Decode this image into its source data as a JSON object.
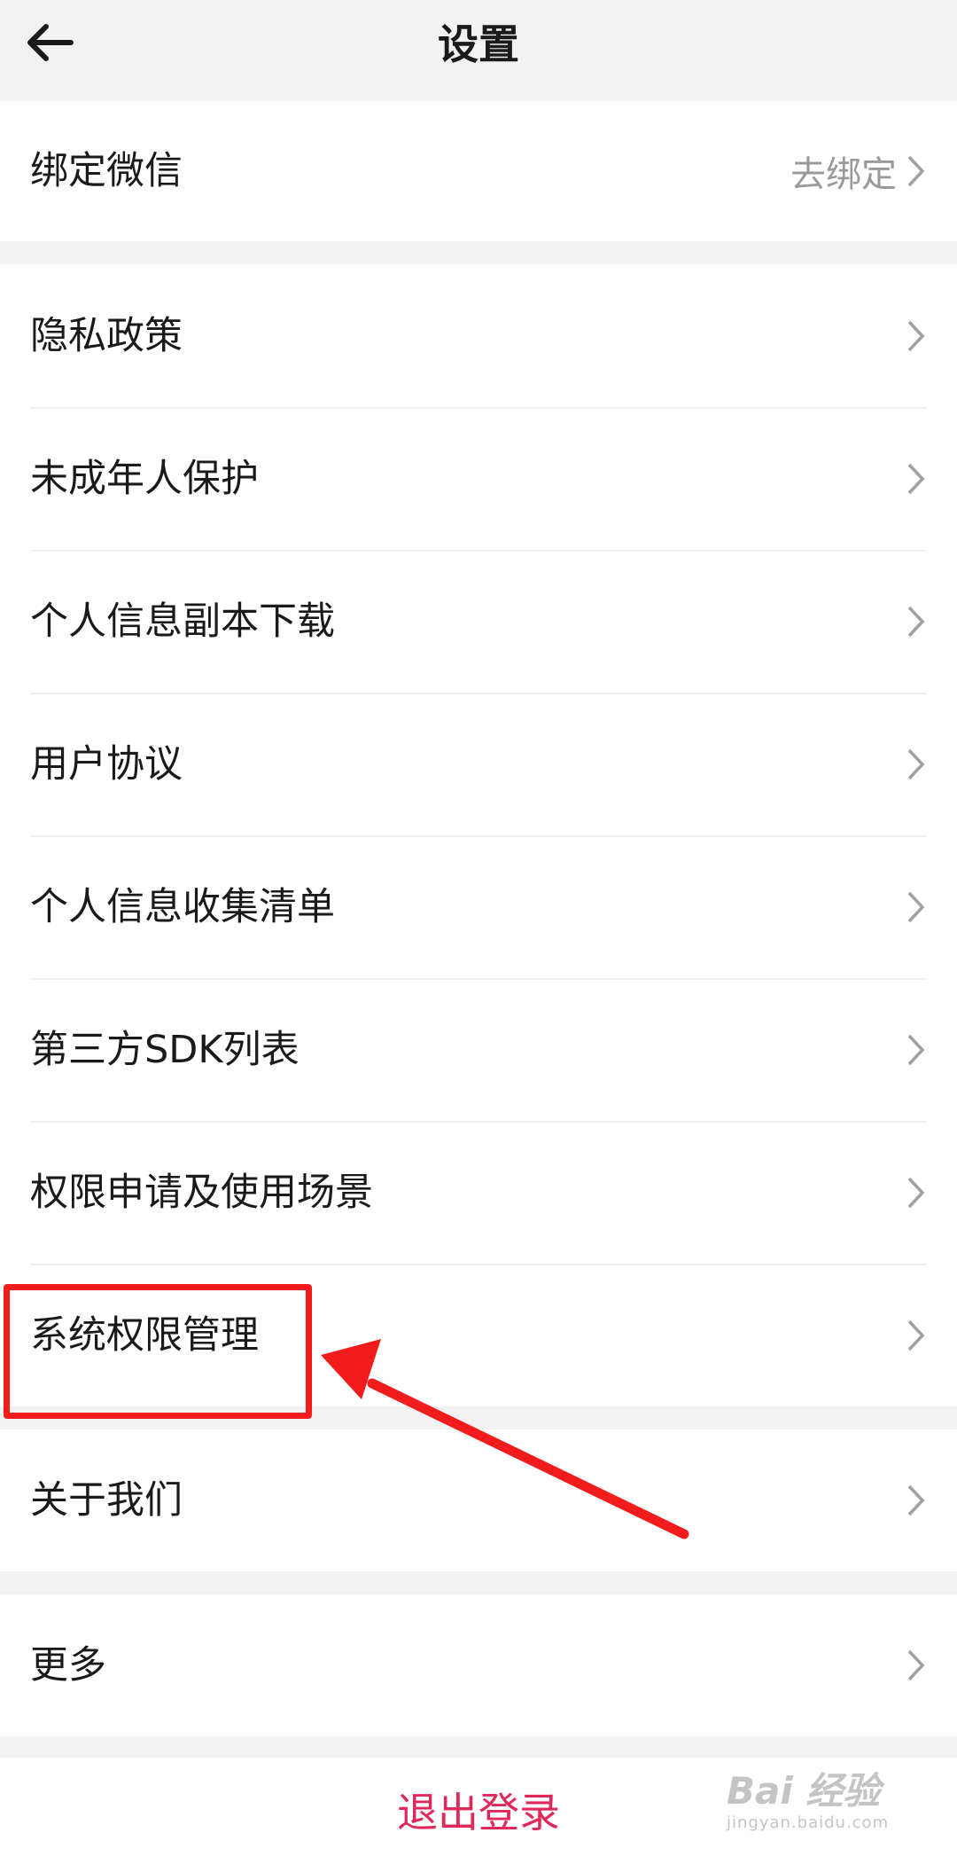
{
  "header": {
    "title": "设置",
    "back_icon": "arrow-left-icon"
  },
  "wechat_group": {
    "label": "绑定微信",
    "value": "去绑定"
  },
  "main_group": {
    "items": [
      {
        "label": "隐私政策"
      },
      {
        "label": "未成年人保护"
      },
      {
        "label": "个人信息副本下载"
      },
      {
        "label": "用户协议"
      },
      {
        "label": "个人信息收集清单"
      },
      {
        "label": "第三方SDK列表"
      },
      {
        "label": "权限申请及使用场景"
      },
      {
        "label": "系统权限管理"
      }
    ]
  },
  "about_group": {
    "label": "关于我们"
  },
  "more_group": {
    "label": "更多"
  },
  "logout": {
    "label": "退出登录"
  },
  "watermark": {
    "top": "Bai 经验",
    "bottom": "jingyan.baidu.com"
  },
  "colors": {
    "accent": "#e0295a",
    "highlight": "#f21c1c",
    "background": "#f2f2f2"
  }
}
